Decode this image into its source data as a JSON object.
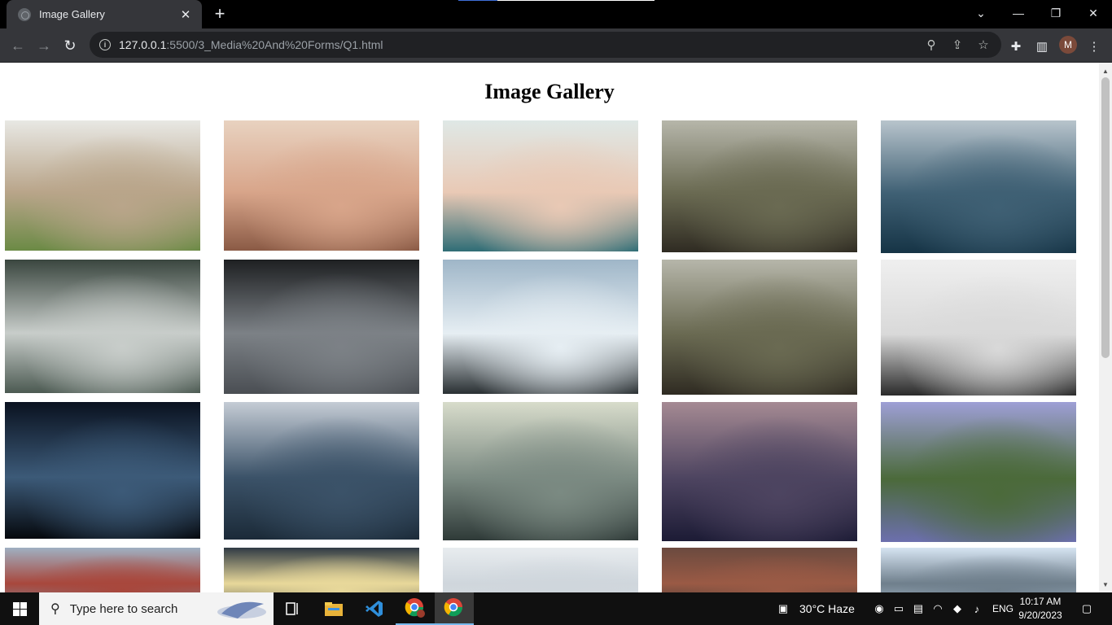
{
  "browser": {
    "tab_title": "Image Gallery",
    "url_host": "127.0.0.1",
    "url_path": ":5500/3_Media%20And%20Forms/Q1.html",
    "profile_initial": "M"
  },
  "page": {
    "title": "Image Gallery",
    "images": [
      {
        "name": "wheat-field",
        "colors": [
          "#e8e8e4",
          "#b9a58a",
          "#6b8a45"
        ]
      },
      {
        "name": "desk-flatlay",
        "colors": [
          "#e8d2c0",
          "#d8a58a",
          "#8a5a45"
        ]
      },
      {
        "name": "car-window-couple",
        "colors": [
          "#dfe8e6",
          "#e9c9b5",
          "#2f6d76"
        ]
      },
      {
        "name": "river-rocks-forest",
        "colors": [
          "#b6b6aa",
          "#6a6a52",
          "#2f2b22"
        ]
      },
      {
        "name": "ocean-liberty",
        "colors": [
          "#b8c4cc",
          "#3f6074",
          "#163446"
        ]
      },
      {
        "name": "foggy-forest",
        "colors": [
          "#3a463f",
          "#c8cdca",
          "#4c5a52"
        ]
      },
      {
        "name": "water-droplets",
        "colors": [
          "#1e2022",
          "#7c8186",
          "#4a4e53"
        ]
      },
      {
        "name": "crashing-wave",
        "colors": [
          "#9fb6c8",
          "#e6eef3",
          "#2a3033"
        ]
      },
      {
        "name": "river-rocks-forest-2",
        "colors": [
          "#b6b6aa",
          "#6a6a52",
          "#2f2b22"
        ]
      },
      {
        "name": "typewriter-parts",
        "colors": [
          "#efefef",
          "#d9d9d9",
          "#2a2a2a"
        ]
      },
      {
        "name": "star-trails-swirl",
        "colors": [
          "#0a1220",
          "#3c5a78",
          "#05080d"
        ]
      },
      {
        "name": "dark-sea",
        "colors": [
          "#c5ccd5",
          "#3b5268",
          "#1b2a38"
        ]
      },
      {
        "name": "misty-railway",
        "colors": [
          "#d8dccb",
          "#7b8a82",
          "#2f3a38"
        ]
      },
      {
        "name": "night-sky-clouds",
        "colors": [
          "#a58a93",
          "#4d4460",
          "#1c1b35"
        ]
      },
      {
        "name": "tree-reflection",
        "colors": [
          "#9e9fd6",
          "#4b6a3a",
          "#6c6fae"
        ]
      },
      {
        "name": "red-bridge",
        "colors": [
          "#9fb0c2",
          "#a8473c",
          "#7e8fa0"
        ]
      },
      {
        "name": "sunset-silhouette",
        "colors": [
          "#2f3a44",
          "#e8d89a",
          "#5b5e55"
        ]
      },
      {
        "name": "pale-sky",
        "colors": [
          "#e8ecef",
          "#cfd6dc",
          "#d8dde1"
        ]
      },
      {
        "name": "city-street",
        "colors": [
          "#6b4a3f",
          "#9a5a45",
          "#3d3935"
        ]
      },
      {
        "name": "mountain-lake",
        "colors": [
          "#d6e4f2",
          "#6f7f8c",
          "#a9bccc"
        ]
      }
    ]
  },
  "taskbar": {
    "search_placeholder": "Type here to search",
    "weather": "30°C  Haze",
    "language": "ENG",
    "time": "10:17 AM",
    "date": "9/20/2023"
  }
}
